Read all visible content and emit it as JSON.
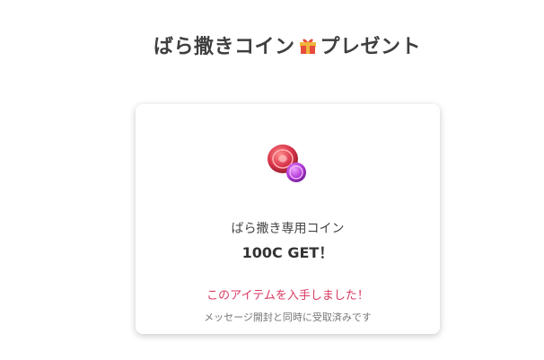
{
  "header": {
    "title_part1": "ばら撒きコイン",
    "title_part2": "プレゼント",
    "gift_icon": "gift-icon"
  },
  "card": {
    "item_icon": "rose-coin-icon",
    "item_name": "ばら撒き専用コイン",
    "item_amount": "100C GET！",
    "obtained_message": "このアイテムを入手しました！",
    "note": "メッセージ開封と同時に受取済みです"
  },
  "colors": {
    "title": "#3f3f3f",
    "accent_pink": "#d93a62",
    "coin_red": "#d8344a",
    "coin_purple": "#b23ad6"
  }
}
